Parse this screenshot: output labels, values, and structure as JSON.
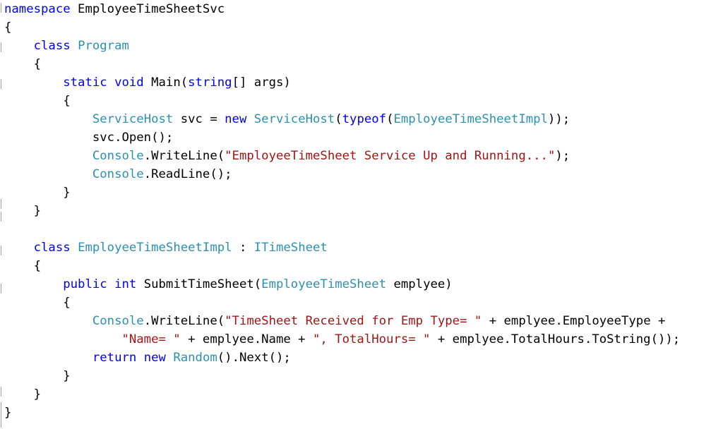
{
  "editor": {
    "colors": {
      "keyword": "#0000ff",
      "type": "#2b91af",
      "string": "#a31515",
      "plain": "#000000",
      "background": "#ffffff"
    },
    "lines": [
      {
        "tokens": [
          {
            "t": "kw",
            "v": "namespace"
          },
          {
            "t": "plain",
            "v": " EmployeeTimeSheetSvc"
          }
        ]
      },
      {
        "tokens": [
          {
            "t": "plain",
            "v": "{"
          }
        ]
      },
      {
        "tokens": [
          {
            "t": "plain",
            "v": "    "
          },
          {
            "t": "kw",
            "v": "class"
          },
          {
            "t": "plain",
            "v": " "
          },
          {
            "t": "type",
            "v": "Program"
          }
        ]
      },
      {
        "tokens": [
          {
            "t": "plain",
            "v": "    {"
          }
        ]
      },
      {
        "tokens": [
          {
            "t": "plain",
            "v": "        "
          },
          {
            "t": "kw",
            "v": "static"
          },
          {
            "t": "plain",
            "v": " "
          },
          {
            "t": "kw",
            "v": "void"
          },
          {
            "t": "plain",
            "v": " Main("
          },
          {
            "t": "kw",
            "v": "string"
          },
          {
            "t": "plain",
            "v": "[] args)"
          }
        ]
      },
      {
        "tokens": [
          {
            "t": "plain",
            "v": "        {"
          }
        ]
      },
      {
        "tokens": [
          {
            "t": "plain",
            "v": "            "
          },
          {
            "t": "type",
            "v": "ServiceHost"
          },
          {
            "t": "plain",
            "v": " svc = "
          },
          {
            "t": "kw",
            "v": "new"
          },
          {
            "t": "plain",
            "v": " "
          },
          {
            "t": "type",
            "v": "ServiceHost"
          },
          {
            "t": "plain",
            "v": "("
          },
          {
            "t": "kw",
            "v": "typeof"
          },
          {
            "t": "plain",
            "v": "("
          },
          {
            "t": "type",
            "v": "EmployeeTimeSheetImpl"
          },
          {
            "t": "plain",
            "v": "));"
          }
        ]
      },
      {
        "tokens": [
          {
            "t": "plain",
            "v": "            svc.Open();"
          }
        ]
      },
      {
        "tokens": [
          {
            "t": "plain",
            "v": "            "
          },
          {
            "t": "type",
            "v": "Console"
          },
          {
            "t": "plain",
            "v": ".WriteLine("
          },
          {
            "t": "str",
            "v": "\"EmployeeTimeSheet Service Up and Running...\""
          },
          {
            "t": "plain",
            "v": ");"
          }
        ]
      },
      {
        "tokens": [
          {
            "t": "plain",
            "v": "            "
          },
          {
            "t": "type",
            "v": "Console"
          },
          {
            "t": "plain",
            "v": ".ReadLine();"
          }
        ]
      },
      {
        "tokens": [
          {
            "t": "plain",
            "v": "        }"
          }
        ]
      },
      {
        "tokens": [
          {
            "t": "plain",
            "v": "    }"
          }
        ]
      },
      {
        "tokens": [
          {
            "t": "plain",
            "v": ""
          }
        ]
      },
      {
        "tokens": [
          {
            "t": "plain",
            "v": "    "
          },
          {
            "t": "kw",
            "v": "class"
          },
          {
            "t": "plain",
            "v": " "
          },
          {
            "t": "type",
            "v": "EmployeeTimeSheetImpl"
          },
          {
            "t": "plain",
            "v": " : "
          },
          {
            "t": "type",
            "v": "ITimeSheet"
          }
        ]
      },
      {
        "tokens": [
          {
            "t": "plain",
            "v": "    {"
          }
        ]
      },
      {
        "tokens": [
          {
            "t": "plain",
            "v": "        "
          },
          {
            "t": "kw",
            "v": "public"
          },
          {
            "t": "plain",
            "v": " "
          },
          {
            "t": "kw",
            "v": "int"
          },
          {
            "t": "plain",
            "v": " SubmitTimeSheet("
          },
          {
            "t": "type",
            "v": "EmployeeTimeSheet"
          },
          {
            "t": "plain",
            "v": " emplyee)"
          }
        ]
      },
      {
        "tokens": [
          {
            "t": "plain",
            "v": "        {"
          }
        ]
      },
      {
        "tokens": [
          {
            "t": "plain",
            "v": "            "
          },
          {
            "t": "type",
            "v": "Console"
          },
          {
            "t": "plain",
            "v": ".WriteLine("
          },
          {
            "t": "str",
            "v": "\"TimeSheet Received for Emp Type= \""
          },
          {
            "t": "plain",
            "v": " + emplyee.EmployeeType +"
          }
        ]
      },
      {
        "tokens": [
          {
            "t": "plain",
            "v": "                "
          },
          {
            "t": "str",
            "v": "\"Name= \""
          },
          {
            "t": "plain",
            "v": " + emplyee.Name + "
          },
          {
            "t": "str",
            "v": "\", TotalHours= \""
          },
          {
            "t": "plain",
            "v": " + emplyee.TotalHours.ToString());"
          }
        ]
      },
      {
        "tokens": [
          {
            "t": "plain",
            "v": "            "
          },
          {
            "t": "kw",
            "v": "return"
          },
          {
            "t": "plain",
            "v": " "
          },
          {
            "t": "kw",
            "v": "new"
          },
          {
            "t": "plain",
            "v": " "
          },
          {
            "t": "type",
            "v": "Random"
          },
          {
            "t": "plain",
            "v": "().Next();"
          }
        ]
      },
      {
        "tokens": [
          {
            "t": "plain",
            "v": "        }"
          }
        ]
      },
      {
        "tokens": [
          {
            "t": "plain",
            "v": "    }"
          }
        ]
      },
      {
        "tokens": [
          {
            "t": "plain",
            "v": "}"
          }
        ]
      }
    ]
  }
}
